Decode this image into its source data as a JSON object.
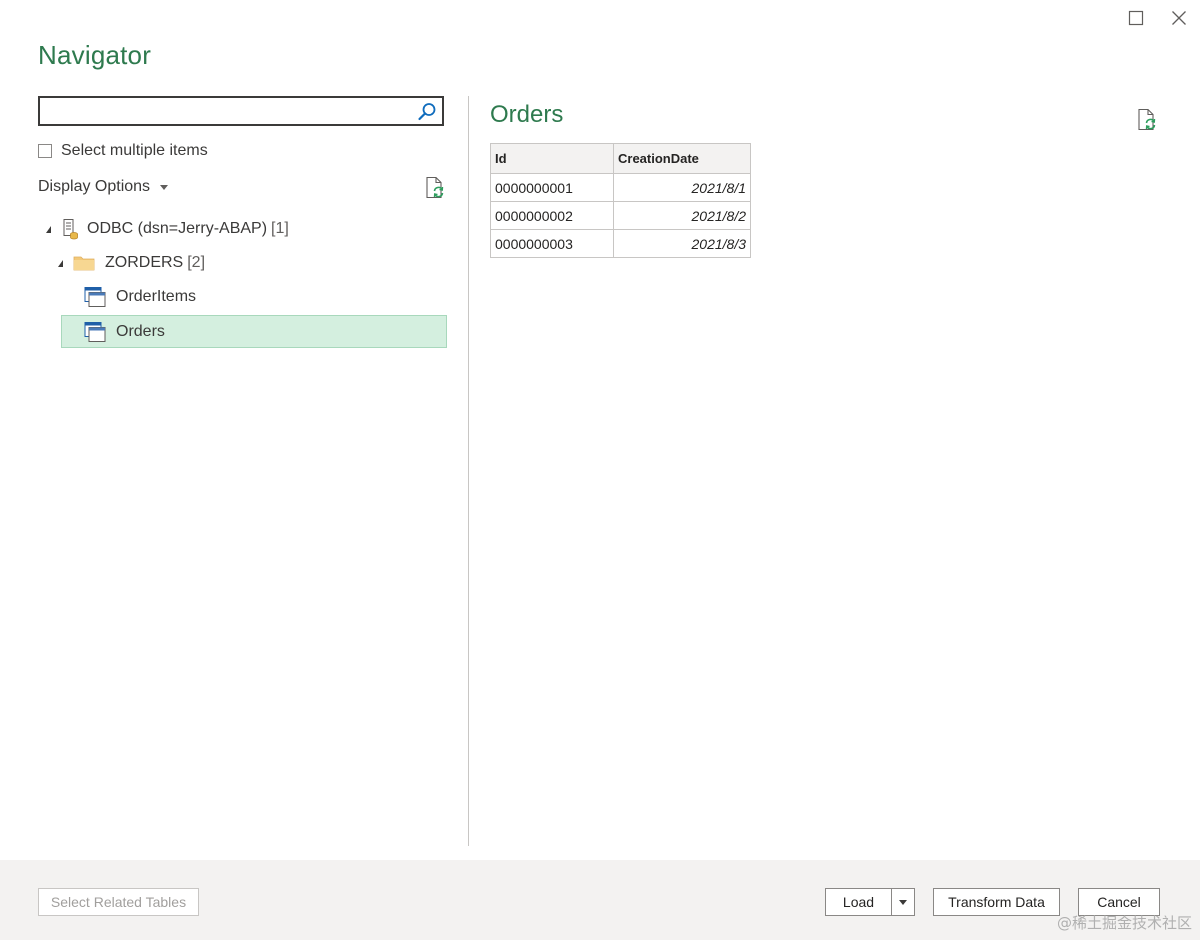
{
  "window": {
    "title": "Navigator"
  },
  "search": {
    "value": "",
    "placeholder": ""
  },
  "select_multiple": {
    "label": "Select multiple items",
    "checked": false
  },
  "display_options": {
    "label": "Display Options"
  },
  "tree": {
    "root": {
      "label": "ODBC (dsn=Jerry-ABAP)",
      "count": "[1]",
      "expanded": true
    },
    "schema": {
      "label": "ZORDERS",
      "count": "[2]",
      "expanded": true
    },
    "tables": [
      {
        "label": "OrderItems",
        "selected": false
      },
      {
        "label": "Orders",
        "selected": true
      }
    ]
  },
  "preview": {
    "title": "Orders",
    "columns": [
      "Id",
      "CreationDate"
    ],
    "rows": [
      [
        "0000000001",
        "2021/8/1"
      ],
      [
        "0000000002",
        "2021/8/2"
      ],
      [
        "0000000003",
        "2021/8/3"
      ]
    ]
  },
  "footer": {
    "select_related_label": "Select Related Tables",
    "load_label": "Load",
    "transform_label": "Transform Data",
    "cancel_label": "Cancel"
  },
  "watermark": "@稀土掘金技术社区",
  "colors": {
    "accent_green": "#2e7a4e",
    "selection_bg": "#d4efdf",
    "footer_bg": "#f3f2f1"
  },
  "icons": {
    "maximize": "maximize-icon",
    "close": "close-icon",
    "search": "search-icon",
    "refresh": "refresh-icon",
    "database": "database-icon",
    "folder": "folder-icon",
    "table": "table-icon",
    "dropdown": "chevron-down-icon"
  }
}
